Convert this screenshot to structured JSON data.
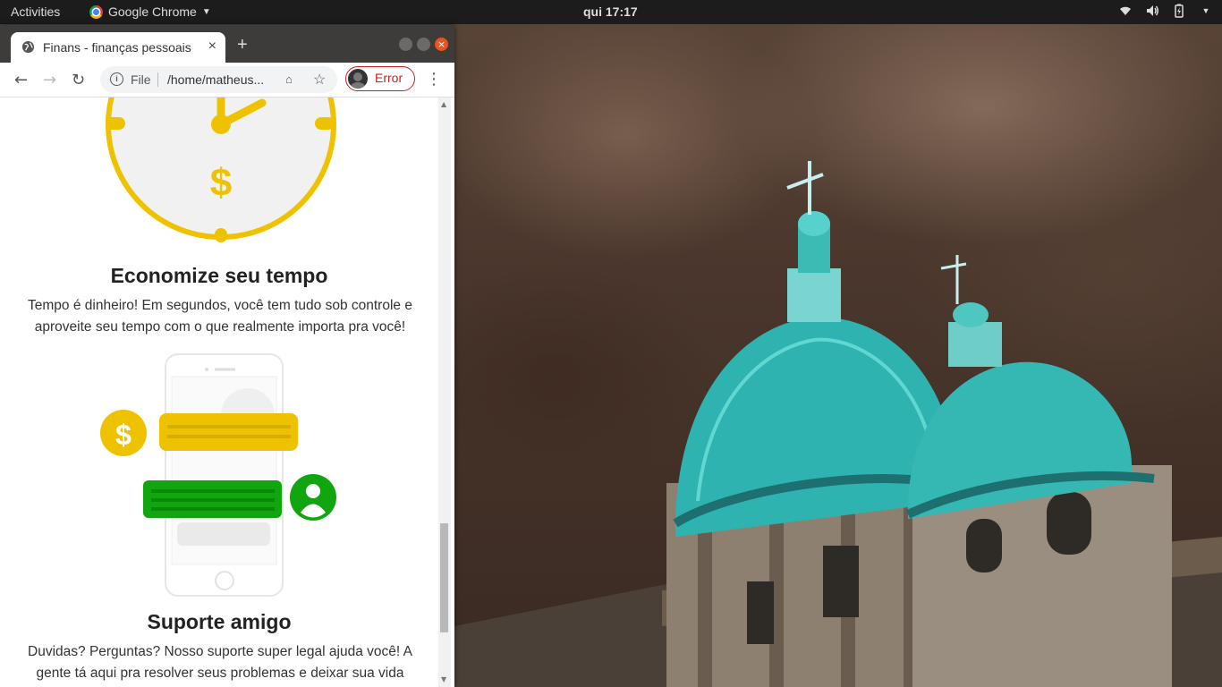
{
  "topbar": {
    "activities": "Activities",
    "app_name": "Google Chrome",
    "clock": "qui 17:17"
  },
  "browser": {
    "tab_title": "Finans - finanças pessoais",
    "tab_close": "×",
    "new_tab": "+",
    "close_button": "×",
    "url_scheme": "File",
    "url": "/home/matheus...",
    "profile_label": "Error"
  },
  "page": {
    "section1": {
      "title": "Economize seu tempo",
      "text": "Tempo é dinheiro! Em segundos, você tem tudo sob controle e aproveite seu tempo com o que realmente importa pra você!"
    },
    "section2": {
      "title": "Suporte amigo",
      "text": "Duvidas? Perguntas? Nosso suporte super legal ajuda você! A gente tá aqui pra resolver seus problemas e deixar sua vida"
    },
    "clock_symbol": "$",
    "chat_symbol": "$"
  },
  "colors": {
    "accent_yellow": "#efc200",
    "accent_green": "#11a50f",
    "error_red": "#c5221f"
  }
}
